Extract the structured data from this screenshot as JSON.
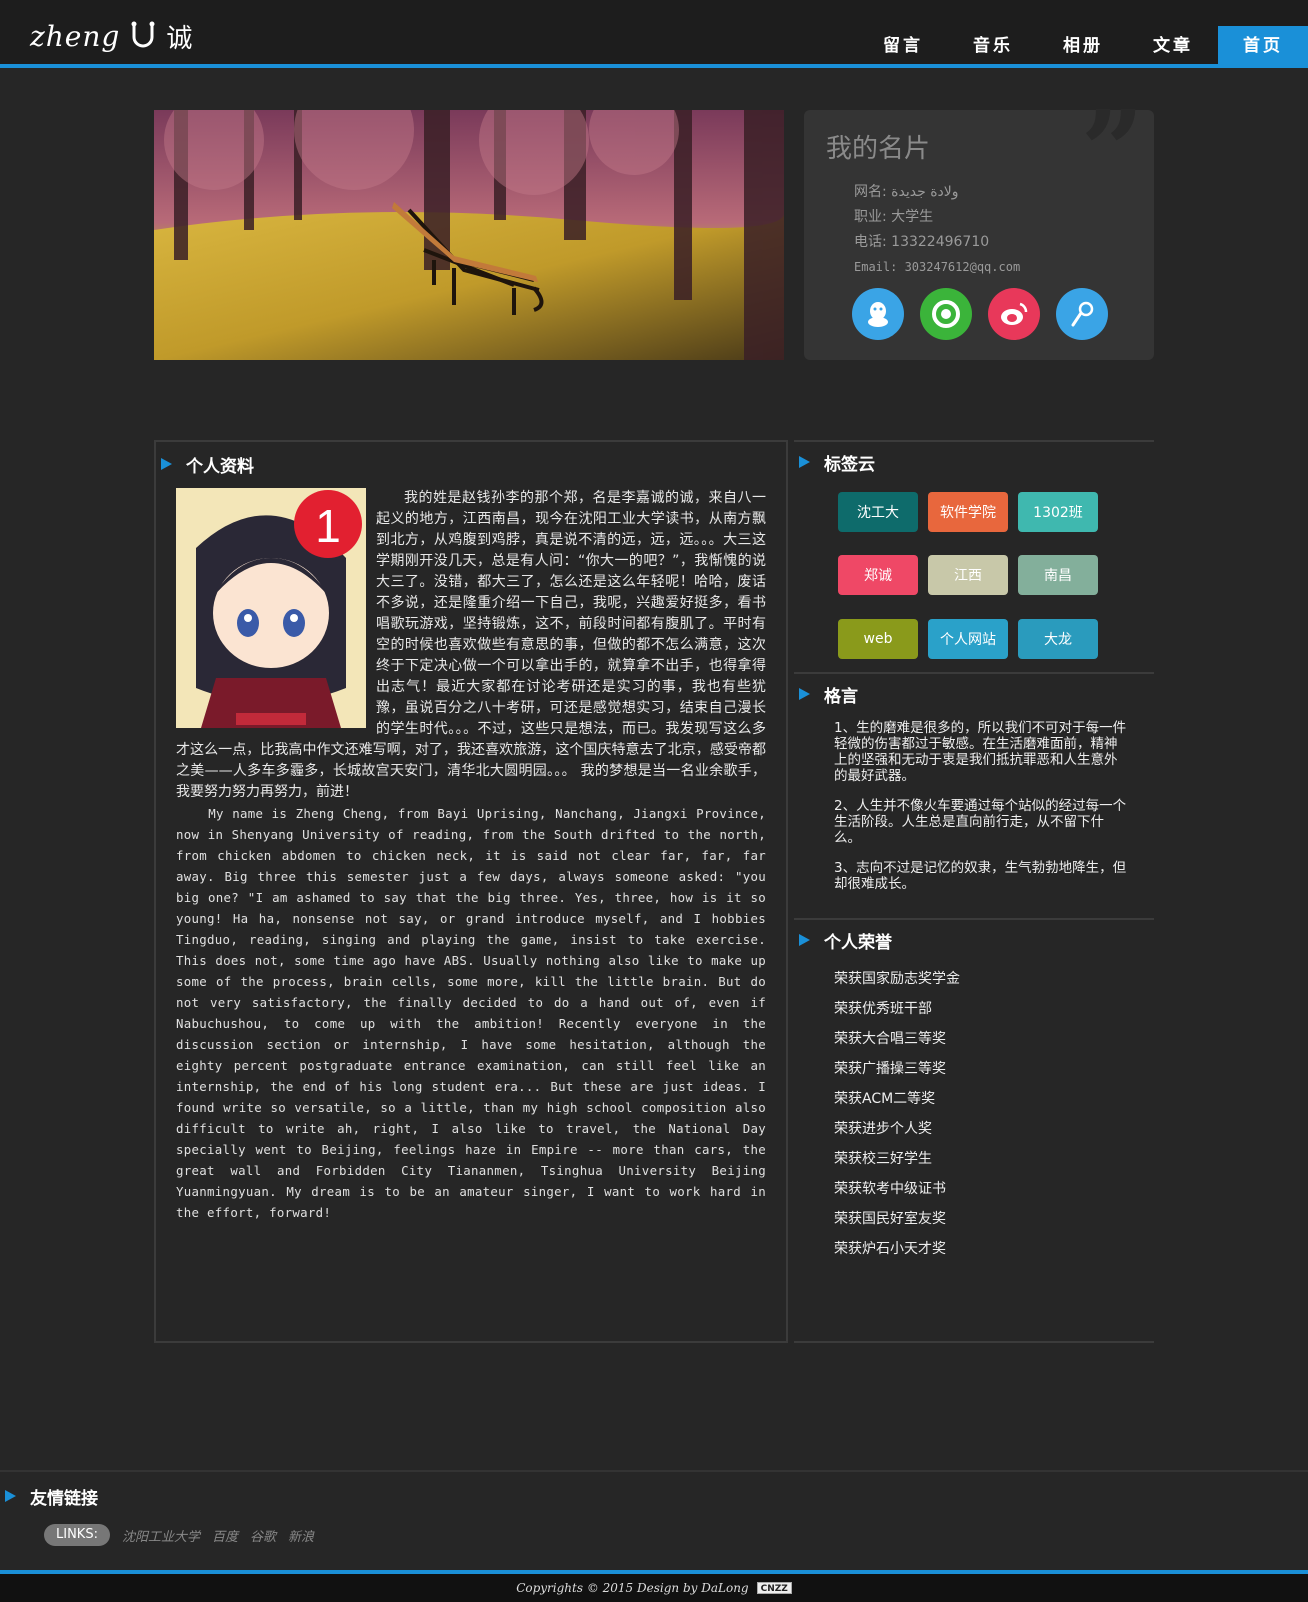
{
  "header": {
    "logo_text": "zheng",
    "logo_cn": "诚",
    "nav": [
      "留言",
      "音乐",
      "相册",
      "文章",
      "首页"
    ]
  },
  "card": {
    "title": "我的名片",
    "quote_mark": "”",
    "name": "网名: ولادة جديدة",
    "job": "职业: 大学生",
    "phone": "电话: 13322496710",
    "email": "Email: 303247612@qq.com",
    "icons": [
      "qq-icon",
      "camera-icon",
      "weibo-icon",
      "music-icon"
    ]
  },
  "profile": {
    "heading": "个人资料",
    "avatar_badge": "1",
    "cn_text": "我的姓是赵钱孙李的那个郑，名是李嘉诚的诚，来自八一起义的地方，江西南昌，现今在沈阳工业大学读书，从南方飘到北方，从鸡腹到鸡脖，真是说不清的远，远，远。。。大三这学期刚开没几天，总是有人问：“你大一的吧？”，我惭愧的说大三了。没错，都大三了，怎么还是这么年轻呢！哈哈，废话不多说，还是隆重介绍一下自己，我呢，兴趣爱好挺多，看书唱歌玩游戏，坚持锻炼，这不，前段时间都有腹肌了。平时有空的时候也喜欢做些有意思的事，但做的都不怎么满意，这次终于下定决心做一个可以拿出手的，就算拿不出手，也得拿得出志气！最近大家都在讨论考研还是实习的事，我也有些犹豫，虽说百分之八十考研，可还是感觉想实习，结束自己漫长的学生时代。。。不过，这些只是想法，而已。我发现写这么多才这么一点，比我高中作文还难写啊，对了，我还喜欢旅游，这个国庆特意去了北京，感受帝都之美——人多车多霾多，长城故宫天安门，清华北大圆明园。。。 我的梦想是当一名业余歌手，我要努力努力再努力，前进！",
    "en_text": "My name is Zheng Cheng, from Bayi Uprising, Nanchang, Jiangxi Province, now in Shenyang University of reading, from the South drifted to the north, from chicken abdomen to chicken neck, it is said not clear far, far, far away. Big three this semester just a few days, always someone asked: \"you big one? \"I am ashamed to say that the big three. Yes, three, how is it so young! Ha ha, nonsense not say, or grand introduce myself, and I hobbies Tingduo, reading, singing and playing the game, insist to take exercise. This does not, some time ago have ABS. Usually nothing also like to make up some of the process, brain cells, some more, kill the little brain. But do not very satisfactory, the finally decided to do a hand out of, even if Nabuchushou, to come up with the ambition! Recently everyone in the discussion section or internship, I have some hesitation, although the eighty percent postgraduate entrance examination, can still feel like an internship, the end of his long student era... But these are just ideas. I found write so versatile, so a little, than my high school composition also difficult to write ah, right, I also like to travel, the National Day specially went to Beijing, feelings haze in Empire -- more than cars, the great wall and Forbidden City Tiananmen, Tsinghua University Beijing Yuanmingyuan. My dream is to be an amateur singer, I want to work hard in the effort, forward!"
  },
  "tags": {
    "heading": "标签云",
    "items": [
      {
        "label": "沈工大",
        "color": "#0e6b6b"
      },
      {
        "label": "软件学院",
        "color": "#e8673d"
      },
      {
        "label": "1302班",
        "color": "#3fb8af"
      },
      {
        "label": "郑诚",
        "color": "#ef4866"
      },
      {
        "label": "江西",
        "color": "#c8c8a9"
      },
      {
        "label": "南昌",
        "color": "#83af9b"
      },
      {
        "label": "web",
        "color": "#8a9a1b"
      },
      {
        "label": "个人网站",
        "color": "#2aa1c9"
      },
      {
        "label": "大龙",
        "color": "#2a9bbd"
      }
    ]
  },
  "motto": {
    "heading": "格言",
    "items": [
      "1、生的磨难是很多的，所以我们不可对于每一件轻微的伤害都过于敏感。在生活磨难面前，精神上的坚强和无动于衷是我们抵抗罪恶和人生意外的最好武器。",
      "2、人生并不像火车要通过每个站似的经过每一个生活阶段。人生总是直向前行走，从不留下什么。",
      "3、志向不过是记忆的奴隶，生气勃勃地降生，但却很难成长。"
    ]
  },
  "honors": {
    "heading": "个人荣誉",
    "items": [
      "荣获国家励志奖学金",
      "荣获优秀班干部",
      "荣获大合唱三等奖",
      "荣获广播操三等奖",
      "荣获ACM二等奖",
      "荣获进步个人奖",
      "荣获校三好学生",
      "荣获软考中级证书",
      "荣获国民好室友奖",
      "荣获炉石小天才奖"
    ]
  },
  "friends": {
    "heading": "友情链接",
    "badge": "LINKS:",
    "links": [
      "沈阳工业大学",
      "百度",
      "谷歌",
      "新浪"
    ]
  },
  "footer": {
    "copyright": "Copyrights © 2015 Design by DaLong",
    "cnzz": "CNZZ"
  },
  "colors": {
    "accent": "#1a90d8",
    "background": "#262626"
  }
}
